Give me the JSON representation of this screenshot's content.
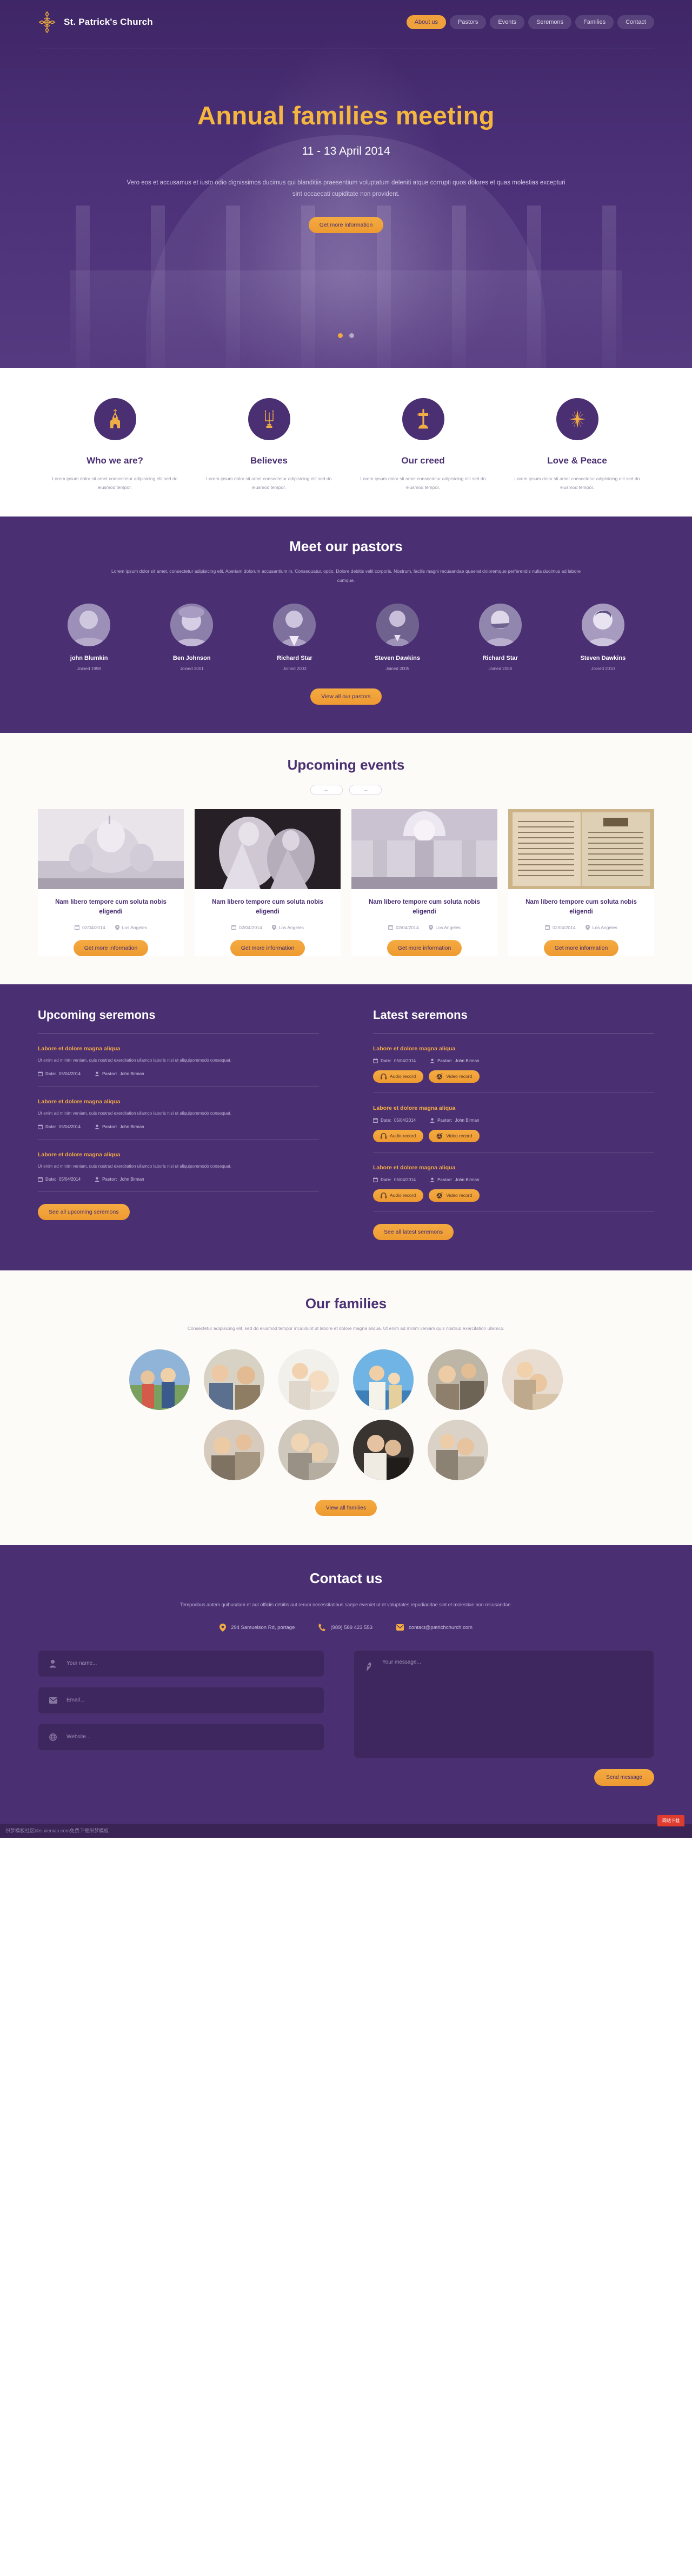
{
  "header": {
    "brand": "St. Patrick's Church",
    "logo_icon": "cross-fleury-icon",
    "menu": [
      {
        "label": "About us",
        "active": true
      },
      {
        "label": "Pastors",
        "active": false
      },
      {
        "label": "Events",
        "active": false
      },
      {
        "label": "Seremons",
        "active": false
      },
      {
        "label": "Families",
        "active": false
      },
      {
        "label": "Contact",
        "active": false
      }
    ]
  },
  "hero": {
    "title": "Annual families meeting",
    "date": "11 - 13 April 2014",
    "text": "Vero eos et accusamus et iusto odio dignissimos ducimus qui blanditiis praesentium voluptatum deleniti atque corrupti quos dolores et quas molestias excepturi sint occaecati cupiditate non provident.",
    "cta": "Get more information",
    "slides": 2,
    "active_slide": 0
  },
  "features": [
    {
      "icon": "church-icon",
      "title": "Who we are?",
      "text": "Lorem ipsum dolor sit amet consectetur adipisicing elit sed do eiusmod tempor."
    },
    {
      "icon": "candelabra-icon",
      "title": "Believes",
      "text": "Lorem ipsum dolor sit amet consectetur adipisicing elit sed do eiusmod tempor."
    },
    {
      "icon": "cross-icon",
      "title": "Our creed",
      "text": "Lorem ipsum dolor sit amet consectetur adipisicing elit sed do eiusmod tempor."
    },
    {
      "icon": "star-burst-icon",
      "title": "Love & Peace",
      "text": "Lorem ipsum dolor sit amet consectetur adipisicing elit sed do eiusmod tempor."
    }
  ],
  "pastors": {
    "title": "Meet our pastors",
    "subtitle": "Lorem ipsum dolor sit amet, consectetur adipisicing elit. Aperiam dolorum accusantium in. Consequatur, optio. Dolore debitis velit corporis. Nostrum, facilis magni recusandae quaerat doloremque perferendis nulla ducimus ad labore cumque.",
    "cta": "View all our pastors",
    "people": [
      {
        "name": "john Blumkin",
        "joined": "Joined 1998"
      },
      {
        "name": "Ben Johnson",
        "joined": "Joined 2001"
      },
      {
        "name": "Richard Star",
        "joined": "Joined 2003"
      },
      {
        "name": "Steven Dawkins",
        "joined": "Joined 2005"
      },
      {
        "name": "Richard Star",
        "joined": "Joined 2008"
      },
      {
        "name": "Steven Dawkins",
        "joined": "Joined 2010"
      }
    ]
  },
  "events": {
    "title": "Upcoming events",
    "prev_icon": "arrow-left-icon",
    "next_icon": "arrow-right-icon",
    "items": [
      {
        "title": "Nam libero tempore cum soluta nobis eligendi",
        "date": "02/04/2014",
        "place": "Los Angeles",
        "cta": "Get more information"
      },
      {
        "title": "Nam libero tempore cum soluta nobis eligendi",
        "date": "02/04/2014",
        "place": "Los Angeles",
        "cta": "Get more information"
      },
      {
        "title": "Nam libero tempore cum soluta nobis eligendi",
        "date": "02/04/2014",
        "place": "Los Angeles",
        "cta": "Get more information"
      },
      {
        "title": "Nam libero tempore cum soluta nobis eligendi",
        "date": "02/04/2014",
        "place": "Los Angeles",
        "cta": "Get more information"
      }
    ]
  },
  "sermons": {
    "upcoming": {
      "heading": "Upcoming seremons",
      "cta": "See all upcoming seremons",
      "items": [
        {
          "title": "Labore et dolore magna aliqua",
          "desc": "Ut enim ad minim veniam, quis nostrud exercitation ullamco laboris nisi ut aliquipommodo consequat.",
          "date_label": "Date:",
          "date": "05/04/2014",
          "pastor_label": "Pastor:",
          "pastor": "John Birman"
        },
        {
          "title": "Labore et dolore magna aliqua",
          "desc": "Ut enim ad minim veniam, quis nostrud exercitation ullamco laboris nisi ut aliquipommodo consequat.",
          "date_label": "Date:",
          "date": "05/04/2014",
          "pastor_label": "Pastor:",
          "pastor": "John Birman"
        },
        {
          "title": "Labore et dolore magna aliqua",
          "desc": "Ut enim ad minim veniam, quis nostrud exercitation ullamco laboris nisi ut aliquipommodo consequat.",
          "date_label": "Date:",
          "date": "05/04/2014",
          "pastor_label": "Pastor:",
          "pastor": "John Birman"
        }
      ]
    },
    "latest": {
      "heading": "Latest seremons",
      "cta": "See all latest seremons",
      "audio_label": "Audio record",
      "video_label": "Video record",
      "items": [
        {
          "title": "Labore et dolore magna aliqua",
          "date_label": "Date:",
          "date": "05/04/2014",
          "pastor_label": "Pastor:",
          "pastor": "John Birman"
        },
        {
          "title": "Labore et dolore magna aliqua",
          "date_label": "Date:",
          "date": "05/04/2014",
          "pastor_label": "Pastor:",
          "pastor": "John Birman"
        },
        {
          "title": "Labore et dolore magna aliqua",
          "date_label": "Date:",
          "date": "05/04/2014",
          "pastor_label": "Pastor:",
          "pastor": "John Birman"
        }
      ]
    }
  },
  "families": {
    "title": "Our families",
    "subtitle": "Consectetur adipisicing elit, sed do eiusmod tempor incididunt ut labore et dolore magna aliqua. Ut enim ad minim veniam quis nostrud exercitation ullamco.",
    "cta": "View all families",
    "row1_count": 6,
    "row2_count": 4
  },
  "contact": {
    "title": "Contact us",
    "subtitle": "Temporibus autem quibusdam et aut officiis debitis aut rerum necessitatibus saepe eveniet ut et voluptates repudiandae sint et molestiae non recusandae.",
    "address": "294 Samuelson Rd, portage",
    "phone": "(989) 589 423 553",
    "email": "contact@patrichchurch.com",
    "address_icon": "map-pin-icon",
    "phone_icon": "phone-icon",
    "email_icon": "envelope-icon",
    "form": {
      "name_placeholder": "Your name...",
      "email_placeholder": "Email...",
      "website_placeholder": "Website...",
      "message_placeholder": "Your message...",
      "name_icon": "user-icon",
      "email_icon": "envelope-icon",
      "website_icon": "globe-icon",
      "message_icon": "pen-icon",
      "submit": "Send message"
    }
  },
  "footer": {
    "text": "织梦模板社区bbs.xieniao.com免费下载织梦模板",
    "button": "网站下载"
  },
  "colors": {
    "purple": "#4a2f72",
    "purple_dark": "#3a2456",
    "gold": "#f4ab42",
    "gold_dark": "#ee9a31",
    "offwhite": "#fdfbf8",
    "red": "#e03b2f"
  }
}
